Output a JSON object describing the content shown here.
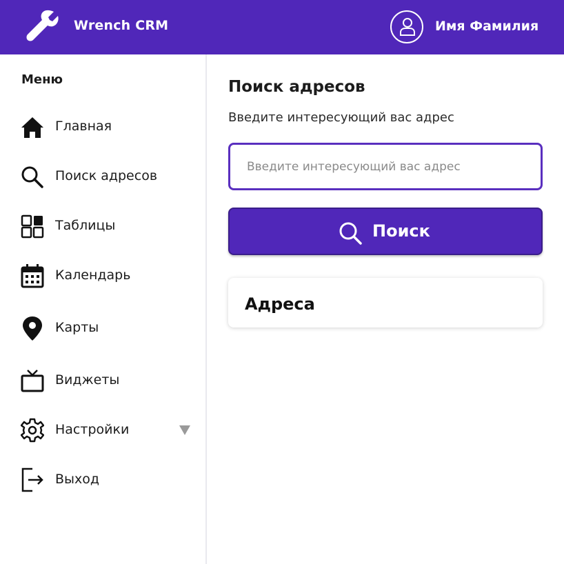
{
  "header": {
    "app_title": "Wrench CRM",
    "logo_icon": "wrench-icon",
    "user_icon": "user-avatar-icon",
    "user_name": "Имя Фамилия",
    "background_color": "#5027b9"
  },
  "sidebar": {
    "menu_title": "Меню",
    "items": [
      {
        "label": "Главная",
        "icon": "home-icon"
      },
      {
        "label": "Поиск адресов",
        "icon": "search-icon"
      },
      {
        "label": "Таблицы",
        "icon": "tables-icon"
      },
      {
        "label": "Календарь",
        "icon": "calendar-icon"
      },
      {
        "label": "Карты",
        "icon": "map-pin-icon"
      },
      {
        "label": "Виджеты",
        "icon": "tv-icon"
      },
      {
        "label": "Настройки",
        "icon": "gear-icon",
        "expandable": true
      },
      {
        "label": "Выход",
        "icon": "logout-icon"
      }
    ]
  },
  "main": {
    "title": "Поиск адресов",
    "subtitle": "Введите интересующий вас адрес",
    "search": {
      "placeholder": "Введите интересующий вас адрес",
      "value": ""
    },
    "search_button": {
      "label": "Поиск",
      "icon": "search-icon"
    },
    "results_card": {
      "title": "Адреса"
    },
    "accent_color": "#5027b9"
  }
}
